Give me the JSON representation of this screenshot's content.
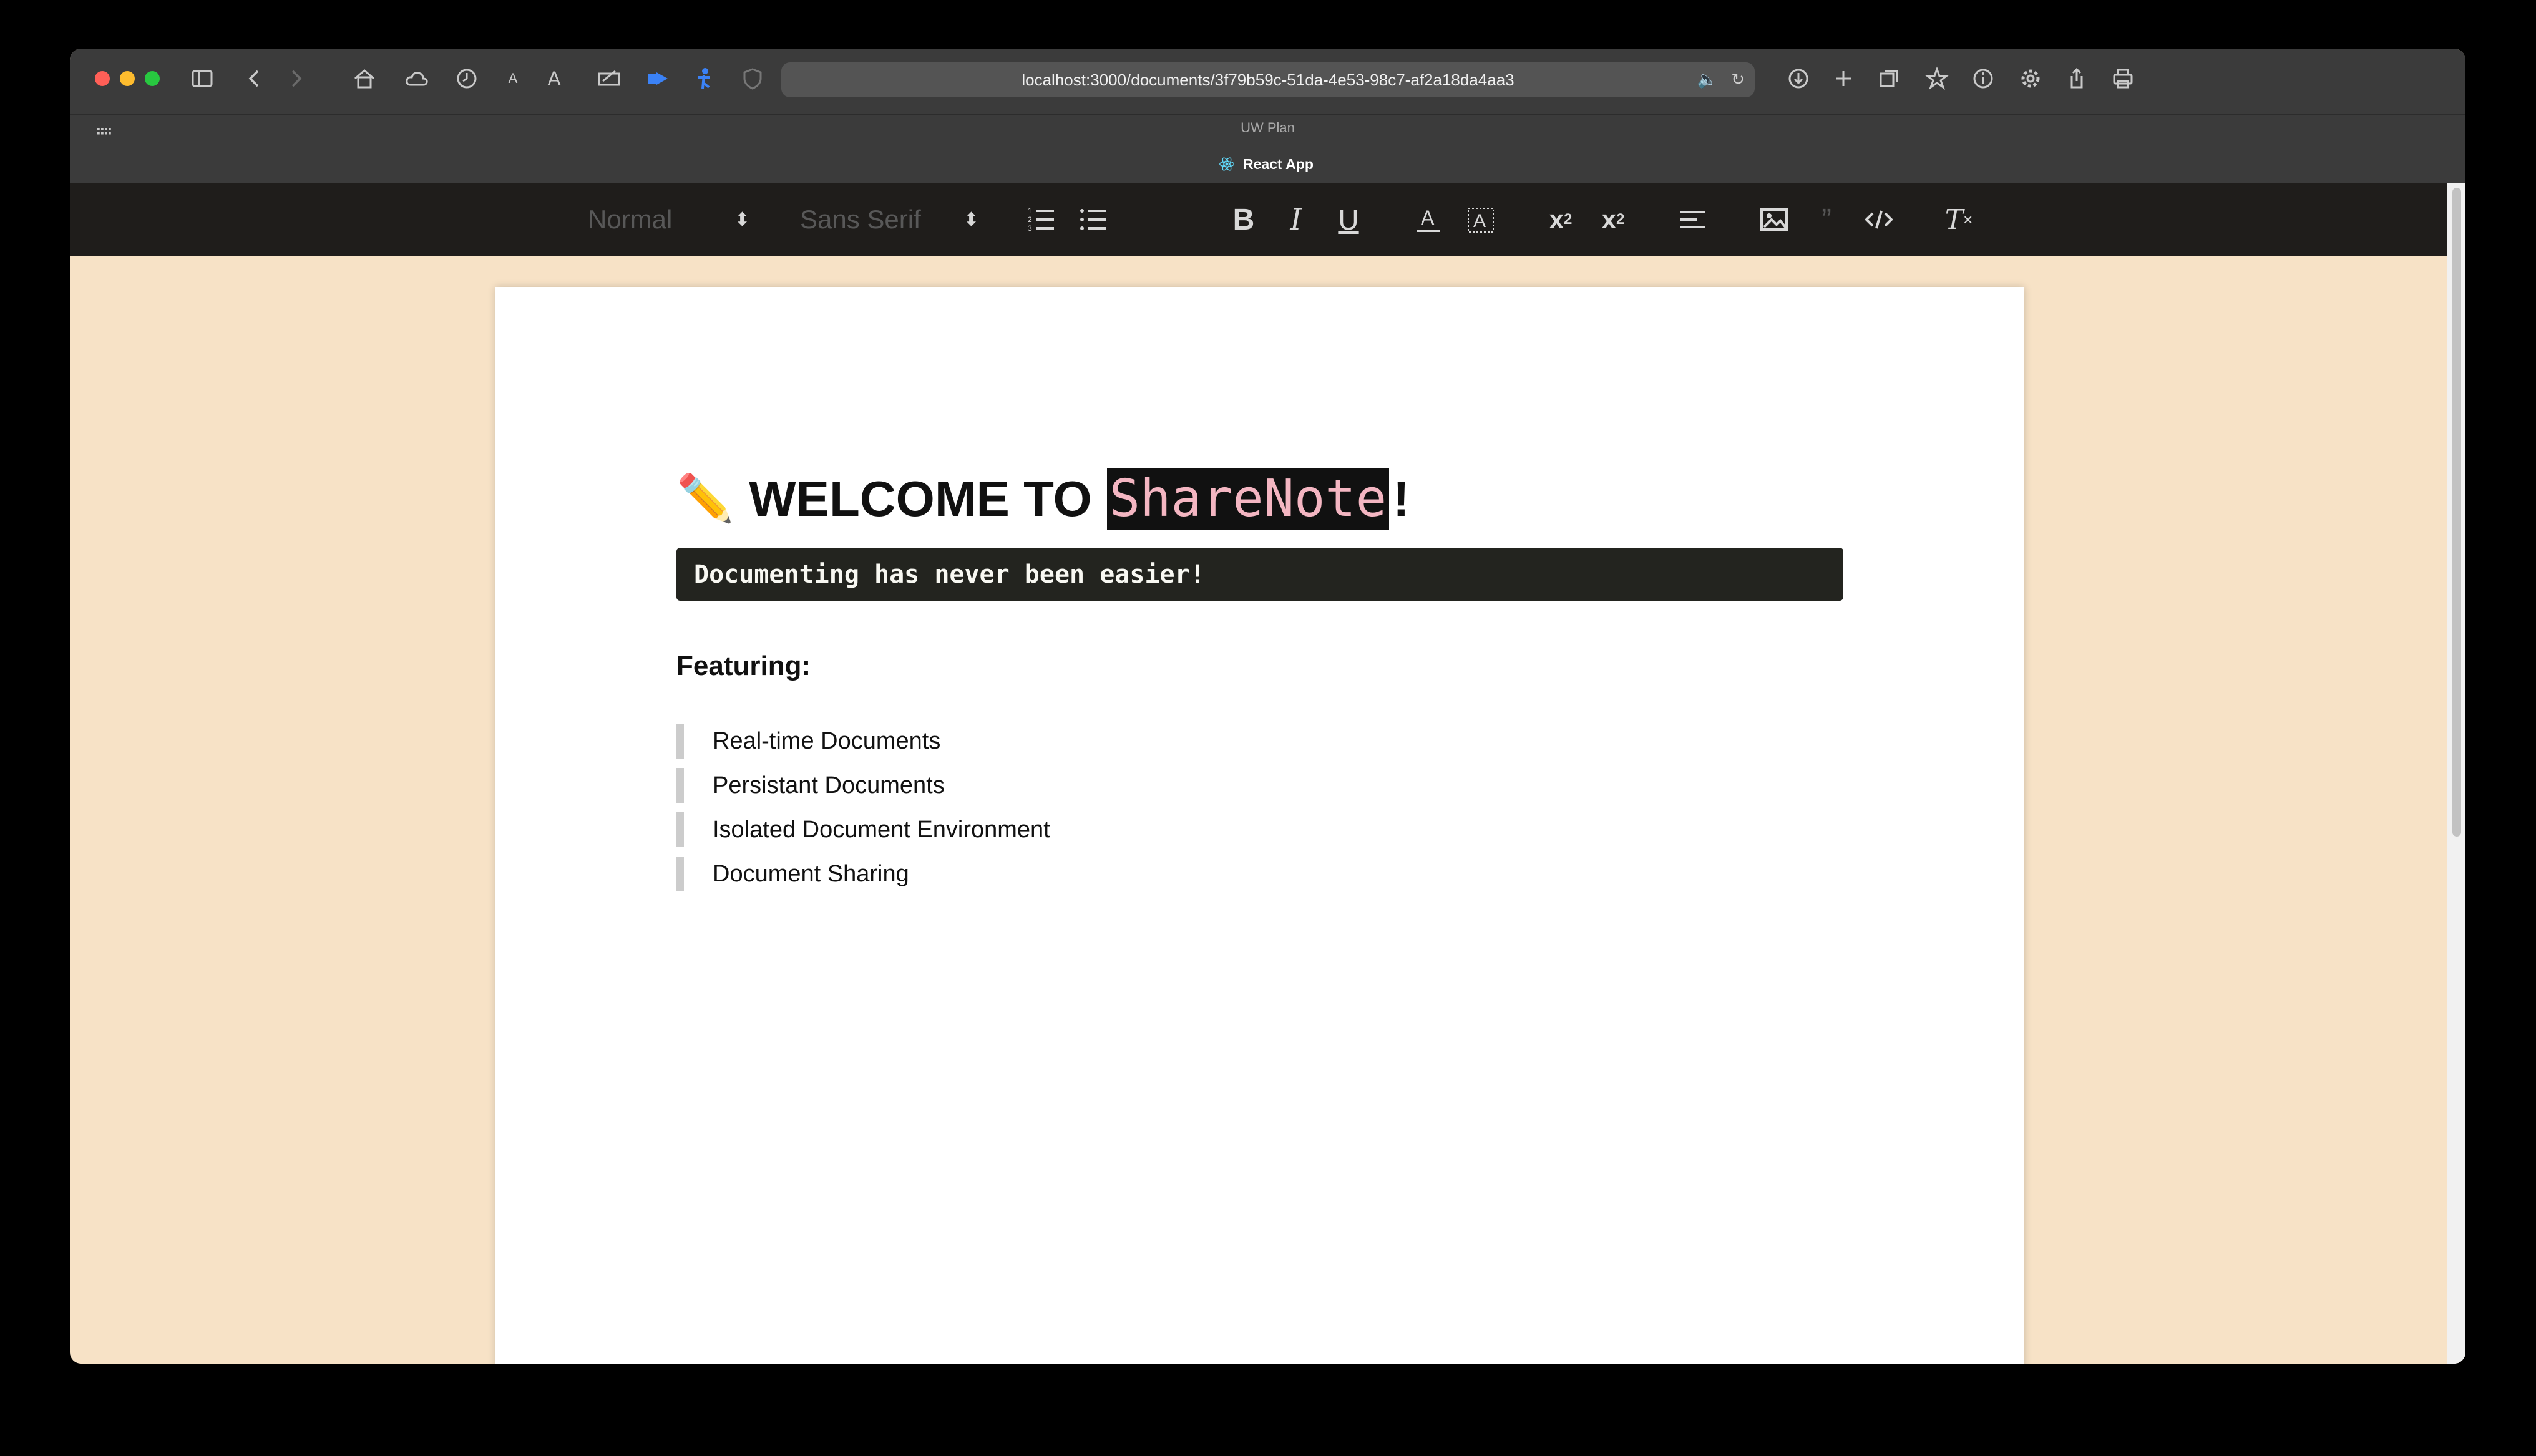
{
  "browser": {
    "url": "localhost:3000/documents/3f79b59c-51da-4e53-98c7-af2a18da4aa3",
    "favorites_title": "UW Plan",
    "tab_title": "React App"
  },
  "editor_toolbar": {
    "header_select": "Normal",
    "font_select": "Sans Serif"
  },
  "document": {
    "title_prefix": "WELCOME TO",
    "title_brand": "ShareNote",
    "title_suffix": "!",
    "code_line": "Documenting has never been easier!",
    "featuring_heading": "Featuring:",
    "features": [
      "Real-time Documents",
      "Persistant Documents",
      "Isolated Document Environment",
      "Document Sharing"
    ]
  },
  "colors": {
    "page_background": "#f7e2c6",
    "toolbar_background": "#1f1d1b",
    "brand_text": "#f4b6c2"
  }
}
